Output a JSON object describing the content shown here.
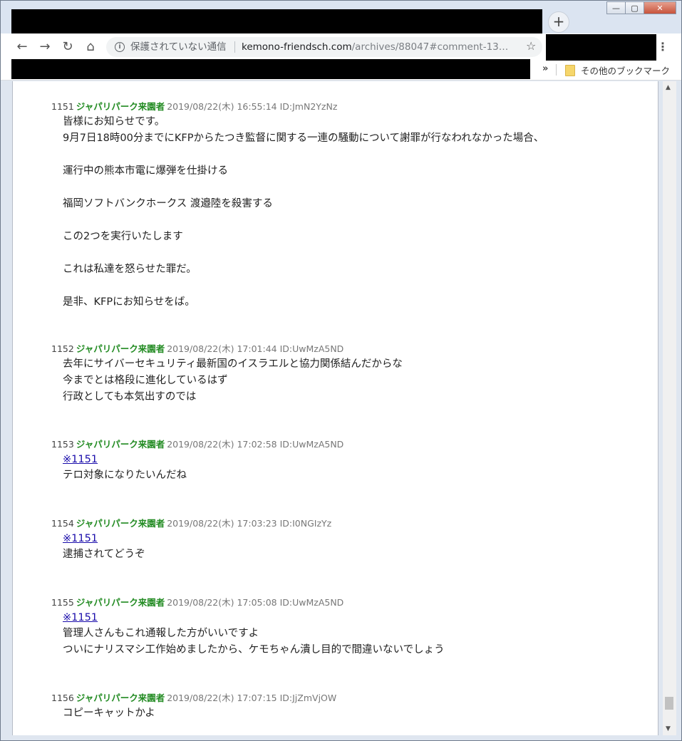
{
  "browser": {
    "new_tab_label": "+",
    "window_controls": {
      "minimize": "—",
      "maximize": "▢",
      "close": "✕"
    },
    "nav": {
      "back": "←",
      "forward": "→",
      "reload": "↻",
      "home": "⌂"
    },
    "security_text": "保護されていない通信",
    "url_host": "kemono-friendsch.com",
    "url_path": "/archives/88047#comment-13…",
    "bookmark_overflow": "»",
    "bookmark_other": "その他のブックマーク",
    "icons": [
      "info-icon",
      "star-icon",
      "menu-icon",
      "folder-icon"
    ]
  },
  "comments": [
    {
      "num": "1151",
      "name": "ジャパリパーク来園者",
      "meta": "2019/08/22(木) 16:55:14 ID:JmN2YzNz",
      "link": "",
      "body": "皆様にお知らせです。\n9月7日18時00分までにKFPからたつき監督に関する一連の騒動について謝罪が行なわれなかった場合、\n\n運行中の熊本市電に爆弾を仕掛ける\n\n福岡ソフトバンクホークス 渡邉陸を殺害する\n\nこの2つを実行いたします\n\nこれは私達を怒らせた罪だ。\n\n是非、KFPにお知らせをば。"
    },
    {
      "num": "1152",
      "name": "ジャパリパーク来園者",
      "meta": "2019/08/22(木) 17:01:44 ID:UwMzA5ND",
      "link": "",
      "body": "去年にサイバーセキュリティ最新国のイスラエルと協力関係結んだからな\n今までとは格段に進化しているはず\n行政としても本気出すのでは"
    },
    {
      "num": "1153",
      "name": "ジャパリパーク来園者",
      "meta": "2019/08/22(木) 17:02:58 ID:UwMzA5ND",
      "link": "※1151",
      "body": "テロ対象になりたいんだね"
    },
    {
      "num": "1154",
      "name": "ジャパリパーク来園者",
      "meta": "2019/08/22(木) 17:03:23 ID:I0NGIzYz",
      "link": "※1151",
      "body": "逮捕されてどうぞ"
    },
    {
      "num": "1155",
      "name": "ジャパリパーク来園者",
      "meta": "2019/08/22(木) 17:05:08 ID:UwMzA5ND",
      "link": "※1151",
      "body": "管理人さんもこれ通報した方がいいですよ\nついにナリスマシ工作始めましたから、ケモちゃん潰し目的で間違いないでしょう"
    },
    {
      "num": "1156",
      "name": "ジャパリパーク来園者",
      "meta": "2019/08/22(木) 17:07:15 ID:JjZmVjOW",
      "link": "",
      "body": "コピーキャットかよ"
    }
  ]
}
